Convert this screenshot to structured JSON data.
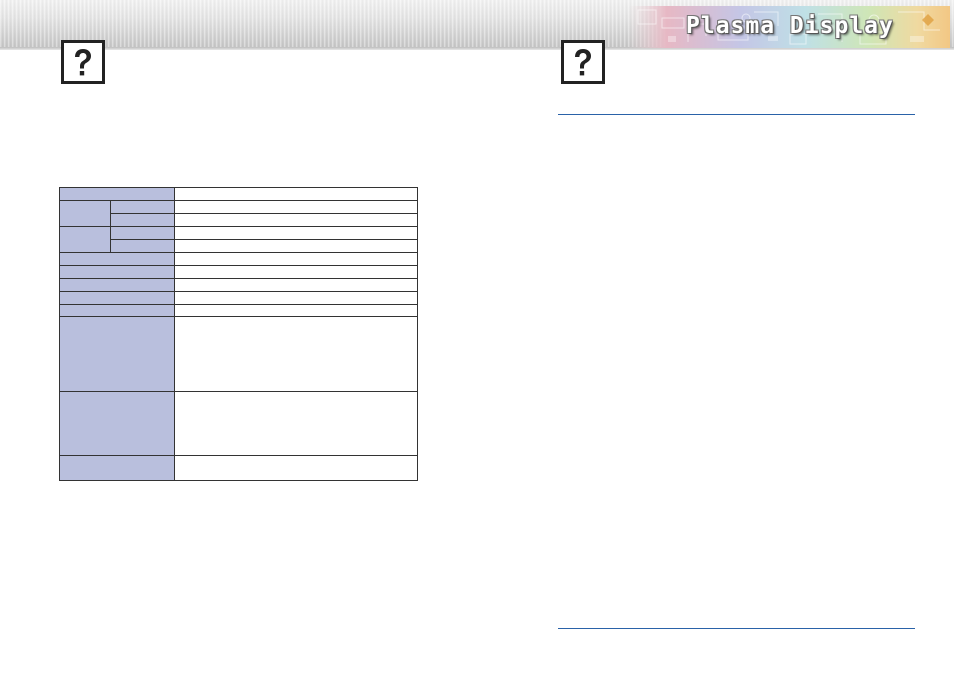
{
  "header": {
    "banner_title": "Plasma Display"
  },
  "left_page": {
    "help_icon": "question-mark-icon"
  },
  "right_page": {
    "help_icon": "question-mark-icon"
  },
  "colors": {
    "table_label_fill": "#b9bfdd",
    "rule_color": "#2a62a8",
    "header_band": "#d4d4d4"
  }
}
